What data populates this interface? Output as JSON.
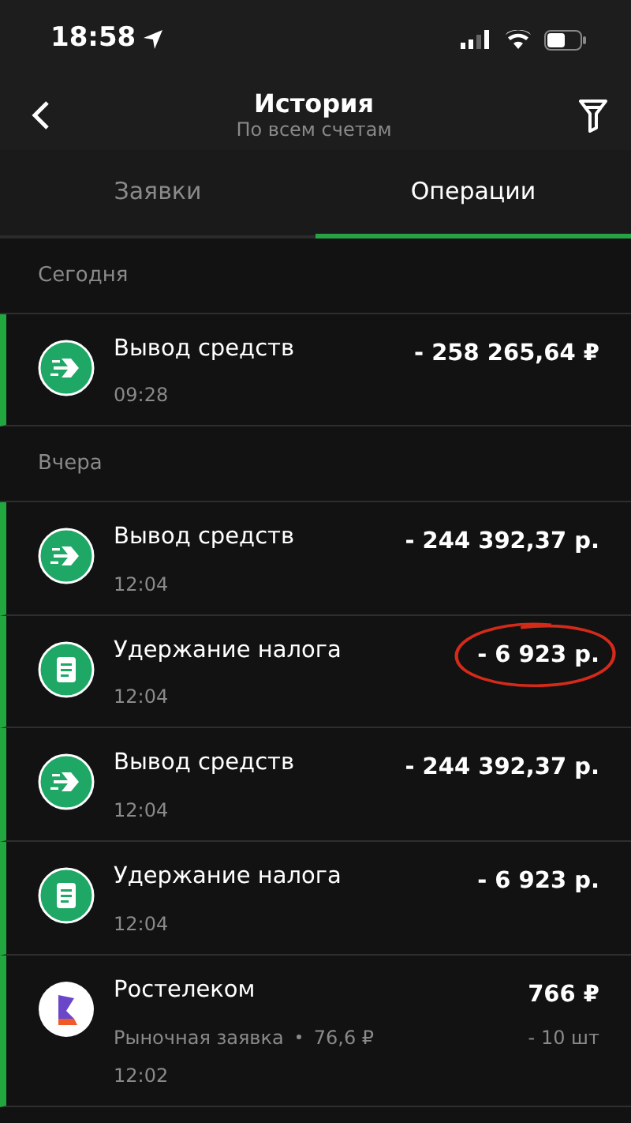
{
  "status_bar": {
    "time": "18:58"
  },
  "header": {
    "title": "История",
    "subtitle": "По всем счетам"
  },
  "tabs": [
    {
      "label": "Заявки",
      "selected": false
    },
    {
      "label": "Операции",
      "selected": true
    }
  ],
  "sections": [
    {
      "title": "Сегодня",
      "items": [
        {
          "kind": "withdrawal",
          "title": "Вывод средств",
          "amount": "- 258 265,64 ₽",
          "time": "09:28",
          "marked": true,
          "circled": false
        }
      ]
    },
    {
      "title": "Вчера",
      "items": [
        {
          "kind": "withdrawal",
          "title": "Вывод средств",
          "amount": "- 244 392,37 р.",
          "time": "12:04",
          "marked": true,
          "circled": false
        },
        {
          "kind": "tax",
          "title": "Удержание налога",
          "amount": "- 6 923 р.",
          "time": "12:04",
          "marked": true,
          "circled": true
        },
        {
          "kind": "withdrawal",
          "title": "Вывод средств",
          "amount": "- 244 392,37 р.",
          "time": "12:04",
          "marked": true,
          "circled": false
        },
        {
          "kind": "tax",
          "title": "Удержание налога",
          "amount": "- 6 923 р.",
          "time": "12:04",
          "marked": true,
          "circled": false
        },
        {
          "kind": "stock",
          "title": "Ростелеком",
          "amount": "766 ₽",
          "detail": "Рыночная заявка",
          "price": "76,6 ₽",
          "quantity": "- 10 шт",
          "time": "12:02",
          "marked": true,
          "circled": false
        }
      ]
    }
  ]
}
